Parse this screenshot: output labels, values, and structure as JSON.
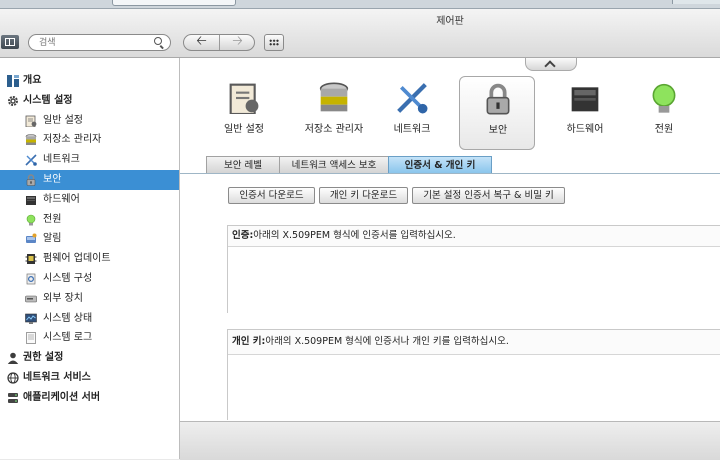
{
  "window": {
    "title": "제어판"
  },
  "search": {
    "placeholder": "검색"
  },
  "sidebar": {
    "items": [
      {
        "label": "개요",
        "level": "top",
        "icon": "overview-icon"
      },
      {
        "label": "시스템 설정",
        "level": "top",
        "icon": "gear-icon"
      },
      {
        "label": "일반 설정",
        "level": "sub",
        "icon": "settings-doc-icon"
      },
      {
        "label": "저장소 관리자",
        "level": "sub",
        "icon": "storage-icon"
      },
      {
        "label": "네트워크",
        "level": "sub",
        "icon": "network-icon"
      },
      {
        "label": "보안",
        "level": "sub",
        "icon": "lock-icon",
        "selected": true
      },
      {
        "label": "하드웨어",
        "level": "sub",
        "icon": "hardware-icon"
      },
      {
        "label": "전원",
        "level": "sub",
        "icon": "bulb-icon"
      },
      {
        "label": "알림",
        "level": "sub",
        "icon": "notification-icon"
      },
      {
        "label": "펌웨어 업데이트",
        "level": "sub",
        "icon": "firmware-icon"
      },
      {
        "label": "시스템 구성",
        "level": "sub",
        "icon": "system-config-icon"
      },
      {
        "label": "외부 장치",
        "level": "sub",
        "icon": "external-device-icon"
      },
      {
        "label": "시스템 상태",
        "level": "sub",
        "icon": "monitor-icon"
      },
      {
        "label": "시스템 로그",
        "level": "sub",
        "icon": "log-icon"
      },
      {
        "label": "권한 설정",
        "level": "top",
        "icon": "user-icon"
      },
      {
        "label": "네트워크 서비스",
        "level": "top",
        "icon": "globe-icon"
      },
      {
        "label": "애플리케이션 서버",
        "level": "top",
        "icon": "server-icon"
      }
    ]
  },
  "categories": [
    {
      "label": "일반 설정",
      "icon": "settings-doc-icon"
    },
    {
      "label": "저장소 관리자",
      "icon": "storage-icon"
    },
    {
      "label": "네트워크",
      "icon": "network-icon"
    },
    {
      "label": "보안",
      "icon": "lock-icon",
      "selected": true
    },
    {
      "label": "하드웨어",
      "icon": "hardware-icon"
    },
    {
      "label": "전원",
      "icon": "bulb-icon"
    }
  ],
  "subtabs": [
    {
      "label": "보안 레벨"
    },
    {
      "label": "네트워크 액세스 보호"
    },
    {
      "label": "인증서 & 개인 키",
      "selected": true
    }
  ],
  "actions": {
    "download_cert": "인증서 다운로드",
    "download_key": "개인 키 다운로드",
    "restore_default": "기본 설정 인증서 복구 & 비밀 키"
  },
  "cert_panel": {
    "label": "인증:",
    "instruction": "아래의 X.509PEM 형식에 인증서를 입력하십시오."
  },
  "key_panel": {
    "label": "개인 키:",
    "instruction": "아래의 X.509PEM 형식에 인증서나 개인 키를 입력하십시오."
  },
  "colors": {
    "selection": "#3b8fd4",
    "active_tab": "#8ac5ec"
  }
}
